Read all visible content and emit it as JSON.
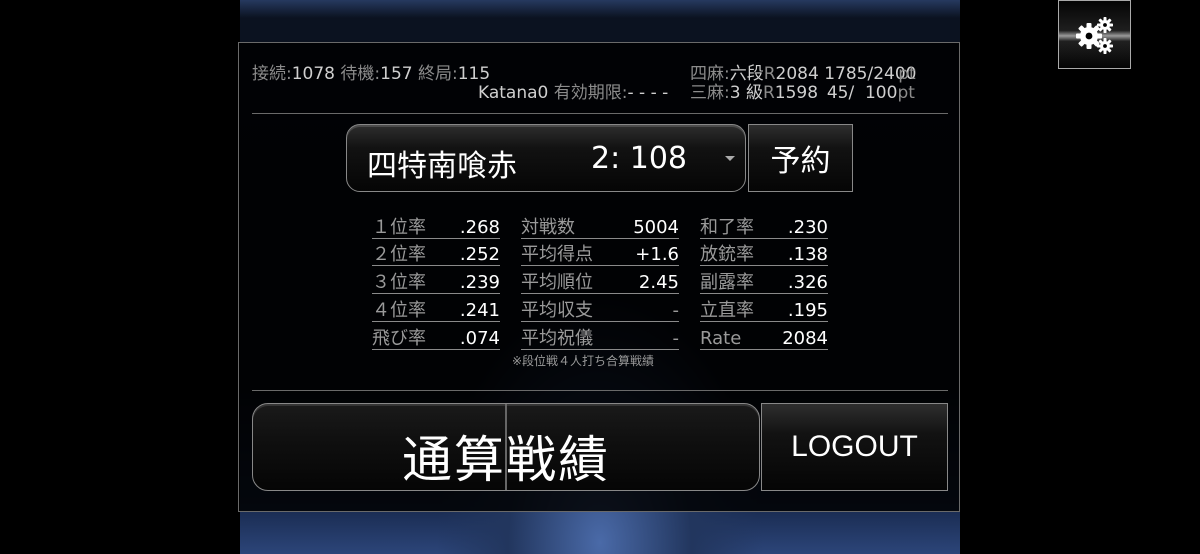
{
  "status": {
    "connect_label": "接続:",
    "connect_value": "1078",
    "waiting_label": "待機:",
    "waiting_value": "157",
    "finished_label": "終局:",
    "finished_value": "115",
    "username": "Katana0",
    "expiry_label": "有効期限:",
    "expiry_value": "- - - -"
  },
  "ranks": {
    "four": {
      "mode": "四麻:",
      "dan": "六段",
      "r_label": "R",
      "rating": "2084",
      "points": "1785/2400",
      "unit": "pt"
    },
    "three": {
      "mode": "三麻:",
      "dan": "3 級",
      "r_label": "R",
      "rating": "1598",
      "points": "45/  100",
      "unit": "pt"
    }
  },
  "rule_select": {
    "name": "四特南喰赤",
    "count": "2: 108"
  },
  "reserve_label": "予約",
  "stats": {
    "col1": [
      {
        "label": "１位率",
        "value": ".268"
      },
      {
        "label": "２位率",
        "value": ".252"
      },
      {
        "label": "３位率",
        "value": ".239"
      },
      {
        "label": "４位率",
        "value": ".241"
      },
      {
        "label": "飛び率",
        "value": ".074"
      }
    ],
    "col2": [
      {
        "label": "対戦数",
        "value": "5004"
      },
      {
        "label": "平均得点",
        "value": "+1.6"
      },
      {
        "label": "平均順位",
        "value": "2.45"
      },
      {
        "label": "平均収支",
        "value": "-"
      },
      {
        "label": "平均祝儀",
        "value": "-"
      }
    ],
    "col3": [
      {
        "label": "和了率",
        "value": ".230"
      },
      {
        "label": "放銃率",
        "value": ".138"
      },
      {
        "label": "副露率",
        "value": ".326"
      },
      {
        "label": "立直率",
        "value": ".195"
      },
      {
        "label": "Rate",
        "value": "2084"
      }
    ]
  },
  "footnote": "※段位戦４人打ち合算戦績",
  "total_button_label": "通算戦績",
  "logout_label": "LOGOUT",
  "icons": {
    "settings": "gears-icon"
  }
}
